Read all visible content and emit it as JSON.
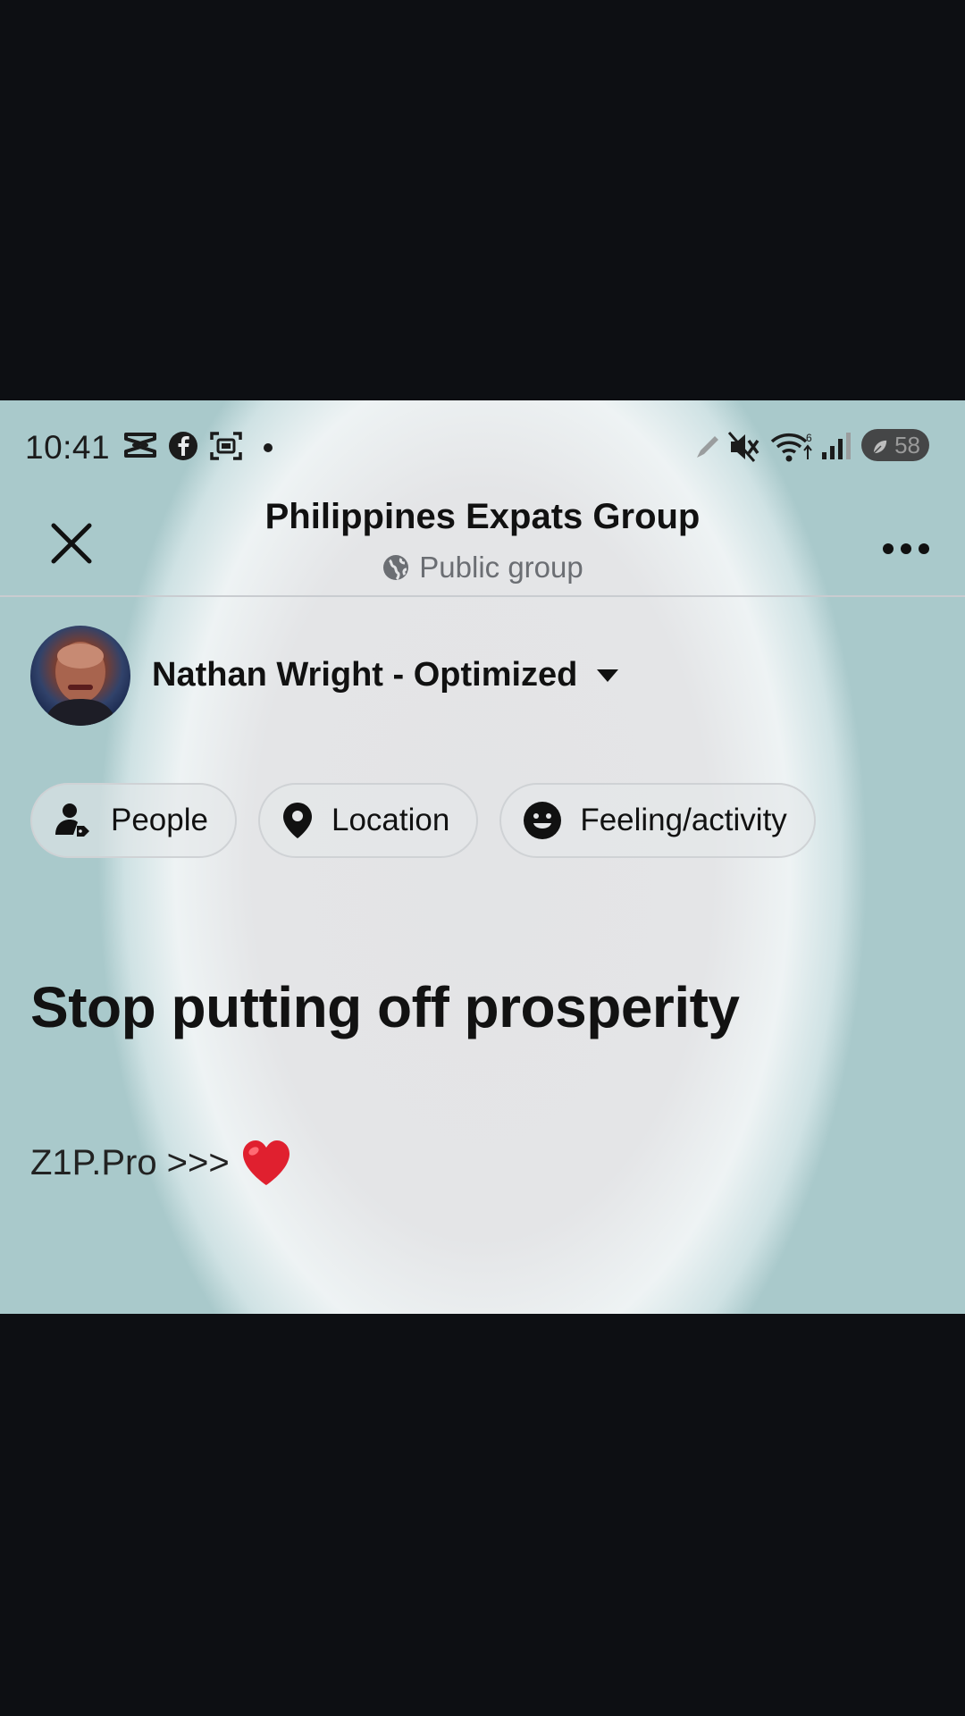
{
  "status_bar": {
    "time": "10:41",
    "icons": [
      "capcut-icon",
      "facebook-icon",
      "screenshot-icon",
      "dot-icon",
      "pen-icon",
      "mute-icon",
      "wifi-icon",
      "signal-icon"
    ],
    "battery": "58"
  },
  "header": {
    "title": "Philippines Expats Group",
    "subtitle": "Public group"
  },
  "author": {
    "name": "Nathan Wright - Optimized"
  },
  "chips": [
    {
      "label": "People",
      "icon": "tag-people-icon"
    },
    {
      "label": "Location",
      "icon": "location-pin-icon"
    },
    {
      "label": "Feeling/activity",
      "icon": "smiley-icon"
    }
  ],
  "post": {
    "headline": "Stop putting off prosperity",
    "body": "Z1P.Pro >>>",
    "emoji": "❤️"
  },
  "colors": {
    "background": "#0d0f13",
    "text": "#111111",
    "subtext": "#6b6e73",
    "heart": "#e0202f"
  }
}
